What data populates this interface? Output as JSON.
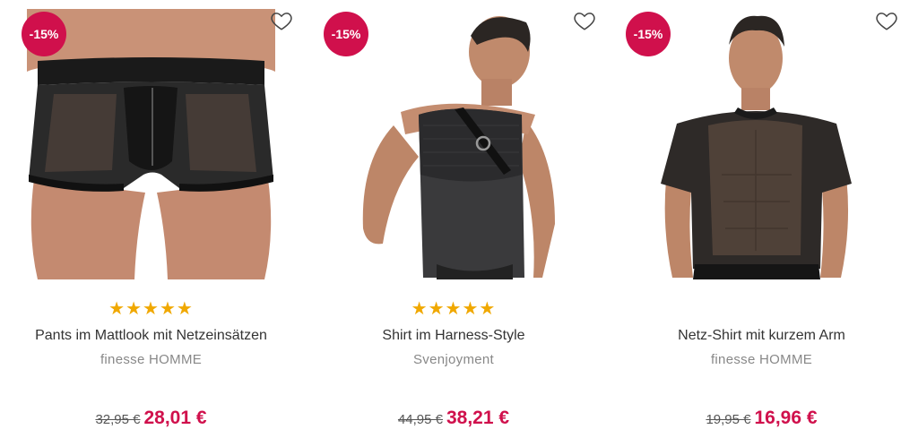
{
  "products": [
    {
      "badge": "-15%",
      "image_alt": "Pants im Mattlook mit Netzeinsätzen",
      "rating_stars": "★★★★★",
      "rating": 5,
      "title": "Pants im Mattlook mit Netzeinsätzen",
      "brand": "finesse HOMME",
      "old_price": "32,95 €",
      "new_price": "28,01 €",
      "wishlist_icon": "heart-outline-icon"
    },
    {
      "badge": "-15%",
      "image_alt": "Shirt im Harness-Style",
      "rating_stars": "★★★★★",
      "rating": 5,
      "title": "Shirt im Harness-Style",
      "brand": "Svenjoyment",
      "old_price": "44,95 €",
      "new_price": "38,21 €",
      "wishlist_icon": "heart-outline-icon"
    },
    {
      "badge": "-15%",
      "image_alt": "Netz-Shirt mit kurzem Arm",
      "rating_stars": "",
      "rating": null,
      "title": "Netz-Shirt mit kurzem Arm",
      "brand": "finesse HOMME",
      "old_price": "19,95 €",
      "new_price": "16,96 €",
      "wishlist_icon": "heart-outline-icon"
    }
  ],
  "colors": {
    "accent": "#d0104c",
    "stars": "#f0a800",
    "brand_text": "#888888"
  }
}
